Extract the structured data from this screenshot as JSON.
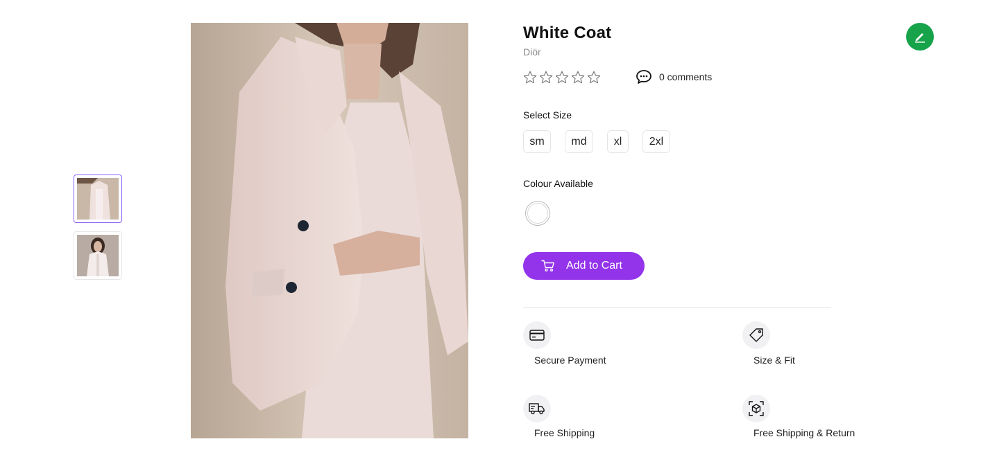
{
  "product": {
    "title": "White Coat",
    "brand": "Diör",
    "rating": 0,
    "rating_max": 5,
    "comments_label": "0 comments"
  },
  "sizes": {
    "label": "Select Size",
    "options": [
      "sm",
      "md",
      "xl",
      "2xl"
    ]
  },
  "colours": {
    "label": "Colour Available",
    "options": [
      "#ffffff"
    ]
  },
  "cart": {
    "label": "Add to Cart",
    "color": "#9333ea"
  },
  "features": [
    {
      "label": "Secure Payment",
      "icon": "credit-card-icon"
    },
    {
      "label": "Size & Fit",
      "icon": "tag-icon"
    },
    {
      "label": "Free Shipping",
      "icon": "truck-icon"
    },
    {
      "label": "Free Shipping & Return",
      "icon": "box-icon"
    }
  ],
  "thumbnails": [
    {
      "icon": "coat-photo-thumbnail",
      "active": true
    },
    {
      "icon": "model-photo-thumbnail",
      "active": false
    }
  ],
  "edit_button": {
    "icon": "pencil-icon",
    "color": "#16a34a"
  }
}
